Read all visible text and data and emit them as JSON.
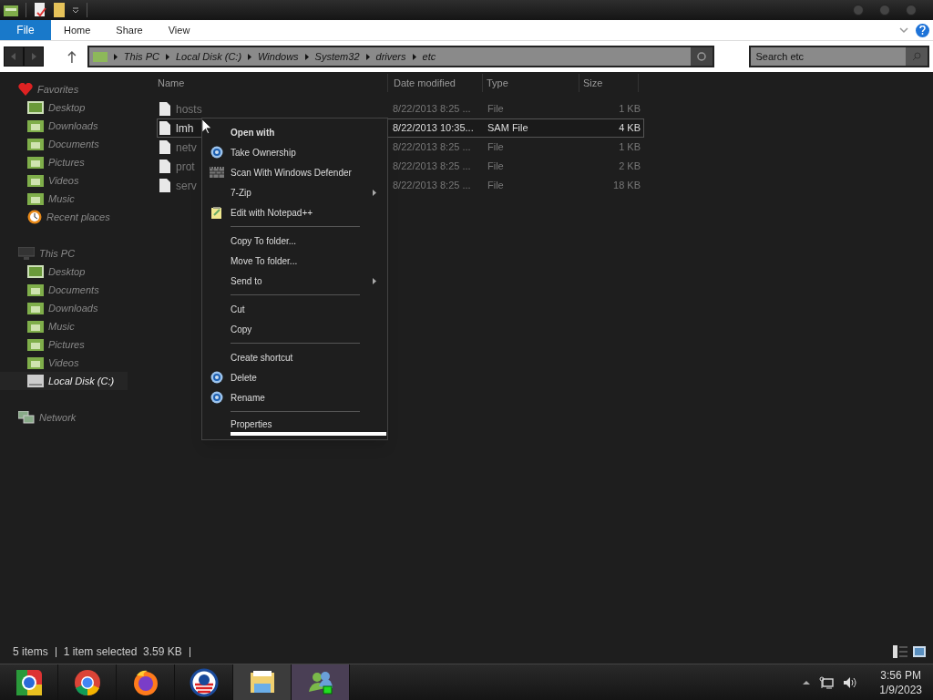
{
  "ribbon": {
    "tabs": [
      {
        "label": "File",
        "selected": true
      },
      {
        "label": "Home",
        "selected": false
      },
      {
        "label": "Share",
        "selected": false
      },
      {
        "label": "View",
        "selected": false
      }
    ]
  },
  "address_bar": {
    "path": [
      "This PC",
      "Local Disk (C:)",
      "Windows",
      "System32",
      "drivers",
      "etc"
    ]
  },
  "search": {
    "placeholder": "Search etc"
  },
  "sidebar": {
    "groups": [
      {
        "label": "Favorites",
        "kind": "favorites",
        "items": [
          {
            "label": "Desktop",
            "kind": "desktop",
            "selected": false
          },
          {
            "label": "Downloads",
            "kind": "folder",
            "selected": false
          },
          {
            "label": "Documents",
            "kind": "folder",
            "selected": false
          },
          {
            "label": "Pictures",
            "kind": "folder",
            "selected": false
          },
          {
            "label": "Videos",
            "kind": "folder",
            "selected": false
          },
          {
            "label": "Music",
            "kind": "folder",
            "selected": false
          },
          {
            "label": "Recent places",
            "kind": "recent",
            "selected": false
          }
        ]
      },
      {
        "label": "This PC",
        "kind": "pc",
        "items": [
          {
            "label": "Desktop",
            "kind": "desktop",
            "selected": false
          },
          {
            "label": "Documents",
            "kind": "folder",
            "selected": false
          },
          {
            "label": "Downloads",
            "kind": "folder",
            "selected": false
          },
          {
            "label": "Music",
            "kind": "folder",
            "selected": false
          },
          {
            "label": "Pictures",
            "kind": "folder",
            "selected": false
          },
          {
            "label": "Videos",
            "kind": "folder",
            "selected": false
          },
          {
            "label": "Local Disk (C:)",
            "kind": "disk",
            "selected": true
          }
        ]
      },
      {
        "label": "Network",
        "kind": "network"
      }
    ]
  },
  "table": {
    "columns": [
      "Name",
      "Date modified",
      "Type",
      "Size"
    ],
    "rows": [
      {
        "name": "hosts",
        "date": "8/22/2013 8:25 ...",
        "type": "File",
        "size": "1 KB",
        "selected": false
      },
      {
        "name": "lmh",
        "date": "8/22/2013 10:35...",
        "type": "SAM File",
        "size": "4 KB",
        "selected": true
      },
      {
        "name": "netv",
        "date": "8/22/2013 8:25 ...",
        "type": "File",
        "size": "1 KB",
        "selected": false
      },
      {
        "name": "prot",
        "date": "8/22/2013 8:25 ...",
        "type": "File",
        "size": "2 KB",
        "selected": false
      },
      {
        "name": "serv",
        "date": "8/22/2013 8:25 ...",
        "type": "File",
        "size": "18 KB",
        "selected": false
      }
    ]
  },
  "context_menu": {
    "items": [
      {
        "kind": "item",
        "label": "Open with",
        "bold": true
      },
      {
        "kind": "gear",
        "label": "Take Ownership"
      },
      {
        "kind": "wall",
        "label": "Scan With Windows Defender"
      },
      {
        "kind": "submenu",
        "label": "7-Zip"
      },
      {
        "kind": "note",
        "label": "Edit with Notepad++"
      },
      {
        "kind": "separator"
      },
      {
        "kind": "item",
        "label": "Copy To folder..."
      },
      {
        "kind": "item",
        "label": "Move To folder..."
      },
      {
        "kind": "submenu",
        "label": "Send to"
      },
      {
        "kind": "separator"
      },
      {
        "kind": "item",
        "label": "Cut"
      },
      {
        "kind": "item",
        "label": "Copy"
      },
      {
        "kind": "separator"
      },
      {
        "kind": "item",
        "label": "Create shortcut"
      },
      {
        "kind": "gear",
        "label": "Delete"
      },
      {
        "kind": "gear",
        "label": "Rename"
      },
      {
        "kind": "separator"
      },
      {
        "kind": "item",
        "label": "Properties",
        "highlighted": true
      }
    ]
  },
  "status_bar": {
    "items": [
      "5 items",
      "1 item selected  3.59 KB"
    ]
  },
  "taskbar": {
    "apps": [
      {
        "kind": "chrome-old",
        "active": false
      },
      {
        "kind": "chrome",
        "active": false
      },
      {
        "kind": "firefox",
        "active": false
      },
      {
        "kind": "logo",
        "active": false
      },
      {
        "kind": "explorer",
        "active": true
      },
      {
        "kind": "people",
        "active": true
      }
    ],
    "time": "3:56 PM",
    "date": "1/9/2023"
  }
}
